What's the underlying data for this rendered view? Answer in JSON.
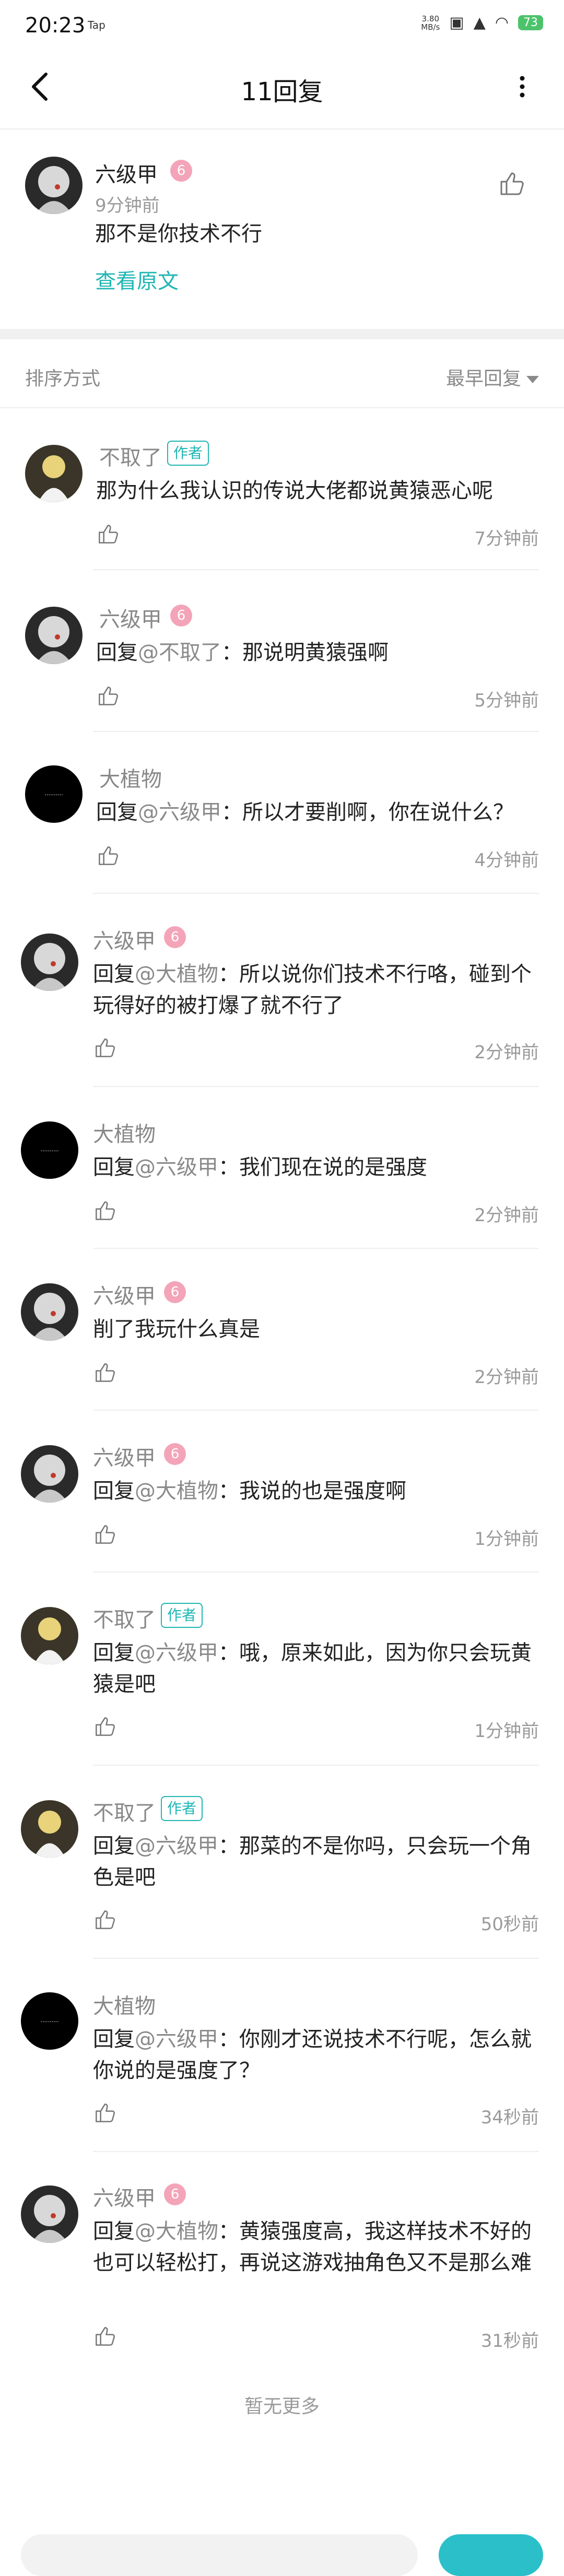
{
  "status_bar": {
    "time": "20:23",
    "tap": "Tap",
    "speed_value": "3.80",
    "speed_unit": "MB/s",
    "battery": "73"
  },
  "header": {
    "title": "11回复"
  },
  "original_post": {
    "user": "六级甲",
    "level": "6",
    "time": "9分钟前",
    "text": "那不是你技术不行",
    "view_original": "查看原文"
  },
  "sort": {
    "label": "排序方式",
    "value": "最早回复"
  },
  "replies": [
    {
      "user": "不取了",
      "author_badge": "作者",
      "mention_prefix": "",
      "mention": "",
      "text": "那为什么我认识的传说大佬都说黄猿恶心呢",
      "time": "7分钟前"
    },
    {
      "user": "六级甲",
      "level": "6",
      "mention_prefix": "回复",
      "mention": "@不取了",
      "text": "：那说明黄猿强啊",
      "time": "5分钟前"
    },
    {
      "user": "大植物",
      "mention_prefix": "回复",
      "mention": "@六级甲",
      "text": "：所以才要削啊，你在说什么？",
      "time": "4分钟前"
    },
    {
      "user": "六级甲",
      "level": "6",
      "mention_prefix": "回复",
      "mention": "@大植物",
      "text": "：所以说你们技术不行咯，碰到个玩得好的被打爆了就不行了",
      "time": "2分钟前"
    },
    {
      "user": "大植物",
      "mention_prefix": "回复",
      "mention": "@六级甲",
      "text": "：我们现在说的是强度",
      "time": "2分钟前"
    },
    {
      "user": "六级甲",
      "level": "6",
      "mention_prefix": "",
      "mention": "",
      "text": "削了我玩什么真是",
      "time": "2分钟前"
    },
    {
      "user": "六级甲",
      "level": "6",
      "mention_prefix": "回复",
      "mention": "@大植物",
      "text": "：我说的也是强度啊",
      "time": "1分钟前"
    },
    {
      "user": "不取了",
      "author_badge": "作者",
      "mention_prefix": "回复",
      "mention": "@六级甲",
      "text": "：哦，原来如此，因为你只会玩黄猿是吧",
      "time": "1分钟前"
    },
    {
      "user": "不取了",
      "author_badge": "作者",
      "mention_prefix": "回复",
      "mention": "@六级甲",
      "text": "：那菜的不是你吗，只会玩一个角色是吧",
      "time": "50秒前"
    },
    {
      "user": "大植物",
      "mention_prefix": "回复",
      "mention": "@六级甲",
      "text": "：你刚才还说技术不行呢，怎么就你说的是强度了？",
      "time": "34秒前"
    },
    {
      "user": "六级甲",
      "level": "6",
      "mention_prefix": "回复",
      "mention": "@大植物",
      "text": "：黄猿强度高，我这样技术不好的也可以轻松打，再说这游戏抽角色又不是那么难",
      "time": "31秒前"
    }
  ],
  "footer": {
    "no_more": "暂无更多"
  },
  "colors": {
    "accent": "#1fb6b3",
    "badge_pink": "#f4a4b8"
  },
  "icons": {
    "back": "chevron-left-icon",
    "more": "more-vertical-icon",
    "like": "thumbs-up-icon"
  }
}
